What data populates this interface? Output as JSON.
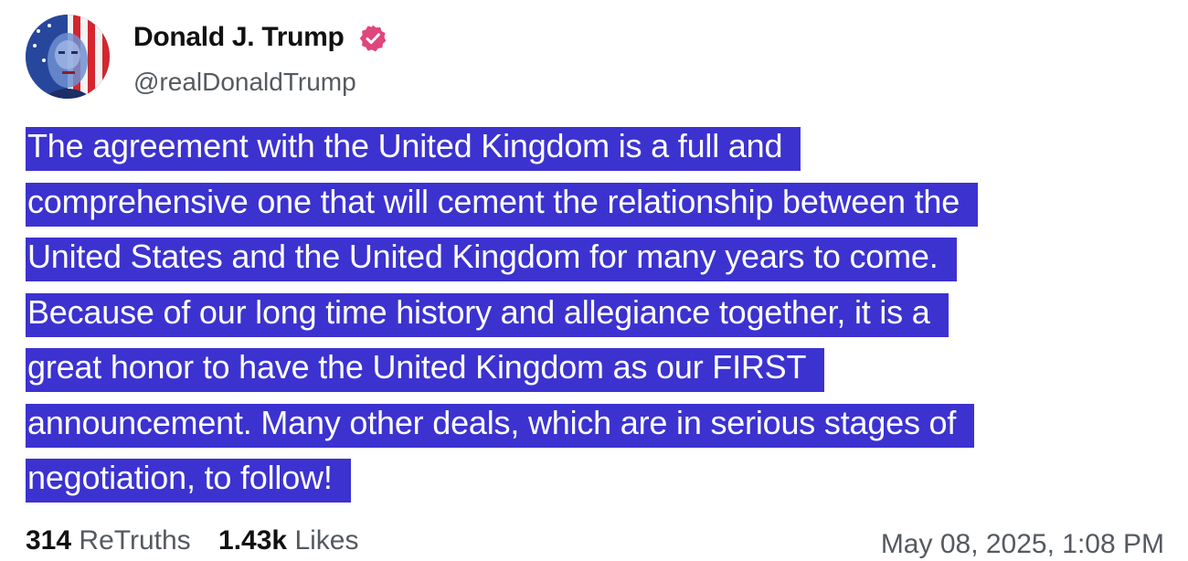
{
  "post": {
    "author": {
      "display_name": "Donald J. Trump",
      "handle": "@realDonaldTrump",
      "verified_icon": "verified-badge-icon",
      "avatar_icon": "profile-avatar-flag-portrait"
    },
    "body_lines": [
      "The agreement with the United Kingdom is a full and",
      "comprehensive one that will cement the relationship between the",
      "United States and the United Kingdom for many years to come.",
      "Because of our long time history and allegiance together, it is a",
      "great honor to have the United Kingdom as our FIRST",
      "announcement. Many other deals, which are in serious stages of",
      "negotiation, to follow!"
    ],
    "stats": {
      "retruths_count": "314",
      "retruths_label": "ReTruths",
      "likes_count": "1.43k",
      "likes_label": "Likes"
    },
    "timestamp": "May 08, 2025, 1:08 PM"
  },
  "colors": {
    "selection_highlight": "#3c32d0",
    "verified_badge": "#e0457b",
    "text_primary": "#111111",
    "text_secondary": "#555a60"
  }
}
